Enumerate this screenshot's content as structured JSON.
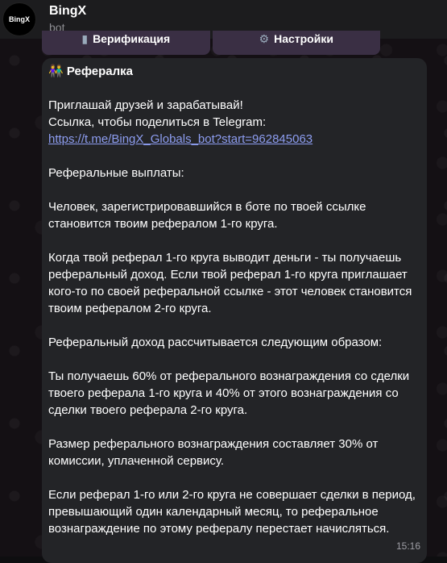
{
  "header": {
    "avatar_text": "BingX",
    "title": "BingX",
    "subtitle": "bot"
  },
  "keyboard": {
    "buttons": [
      {
        "icon": "verify-icon",
        "label": "Верификация"
      },
      {
        "icon": "gear-icon",
        "label": "Настройки"
      }
    ]
  },
  "message": {
    "heading_emoji": "👫",
    "heading": "Рефералка",
    "invite_line": "Приглашай друзей и зарабатывай!",
    "share_line": "Ссылка, чтобы поделиться в Telegram:",
    "link": "https://t.me/BingX_Globals_bot?start=962845063",
    "payouts_title": "Реферальные выплаты:",
    "p1": "Человек, зарегистрировавшийся в боте по твоей ссылке становится твоим рефералом 1-го круга.",
    "p2": "Когда твой реферал 1-го круга выводит деньги - ты получаешь реферальный доход. Если твой реферал 1-го круга приглашает кого-то по своей реферальной ссылке - этот человек становится твоим рефералом 2-го круга.",
    "p3": "Реферальный доход рассчитывается следующим образом:",
    "p4": "Ты получаешь 60% от реферального вознаграждения со сделки твоего реферала 1-го круга и 40% от этого вознаграждения со сделки твоего реферала 2-го круга.",
    "p5": "Размер реферального вознаграждения составляет 30% от комиссии, уплаченной сервису.",
    "p6": "Если реферал 1-го или 2-го круга не совершает сделки в период, превышающий один календарный месяц, то реферальное вознаграждение по этому рефералу перестает начисляться.",
    "time": "15:16"
  }
}
